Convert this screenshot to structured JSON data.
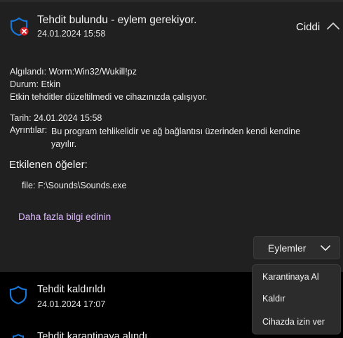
{
  "threat_card": {
    "title": "Tehdit bulundu - eylem gerekiyor.",
    "timestamp": "24.01.2024 15:58",
    "severity": "Ciddi",
    "icon": "shield-alert-icon",
    "collapse_icon": "chevron-up-icon"
  },
  "details": {
    "detected_label": "Algılandı:",
    "detected_value": "Worm:Win32/Wukill!pz",
    "status_label": "Durum:",
    "status_value": "Etkin",
    "status_message": "Etkin tehditler düzeltilmedi ve cihazınızda çalışıyor.",
    "date_label": "Tarih:",
    "date_value": "24.01.2024 15:58",
    "details_label": "Ayrıntılar:",
    "details_value": "Bu program tehlikelidir ve ağ bağlantısı üzerinden kendi kendine yayılır."
  },
  "affected_items": {
    "title": "Etkilenen öğeler:",
    "items": [
      {
        "label": "file:",
        "value": "F:\\Sounds\\Sounds.exe"
      }
    ]
  },
  "links": {
    "more_info": "Daha fazla bilgi edinin"
  },
  "actions": {
    "button_label": "Eylemler",
    "button_icon": "chevron-down-icon",
    "menu_items": [
      {
        "label": "Karantinaya Al"
      },
      {
        "label": "Kaldır"
      },
      {
        "label": "Cihazda izin ver"
      }
    ]
  },
  "history": [
    {
      "title": "Tehdit kaldırıldı",
      "timestamp": "24.01.2024 17:07",
      "icon": "shield-icon"
    },
    {
      "title": "Tehdit karantinaya alındı",
      "icon": "shield-icon"
    }
  ],
  "colors": {
    "shield_blue": "#1677d8",
    "alert_red": "#d91f26",
    "link_purple": "#dcb6ff",
    "panel_background": "#202020",
    "menu_background": "#2c2c2c"
  }
}
